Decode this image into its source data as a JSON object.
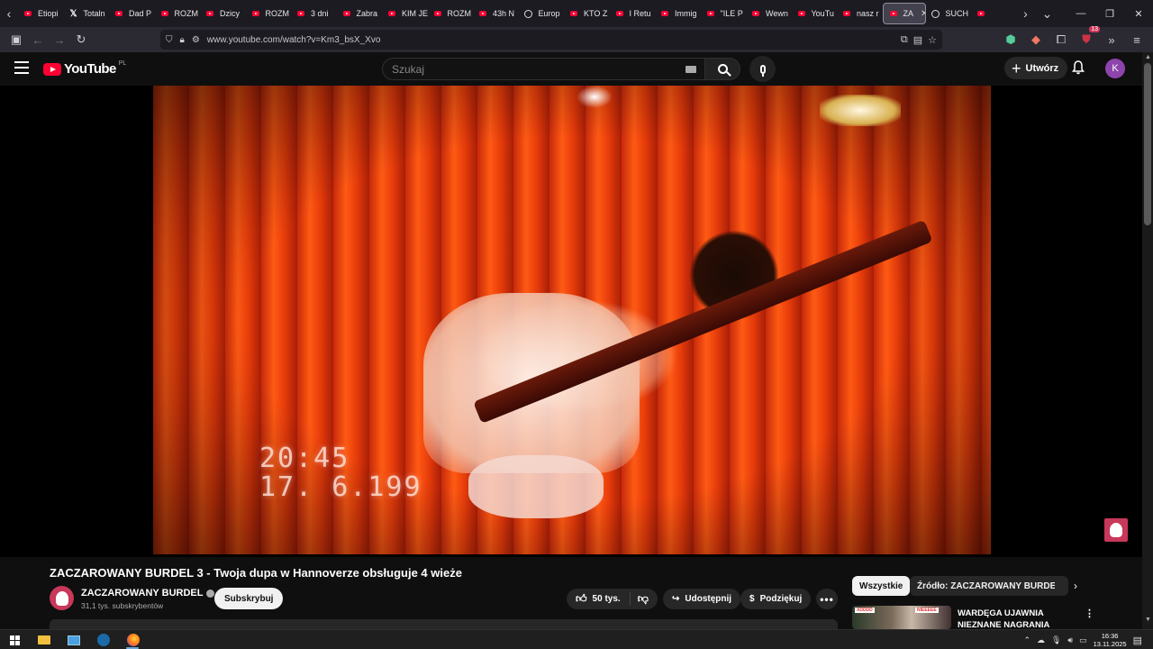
{
  "browser": {
    "tabs": [
      {
        "label": "Etiopi",
        "icon": "youtube-icon"
      },
      {
        "label": "Totaln",
        "icon": "x-icon"
      },
      {
        "label": "Dad P",
        "icon": "youtube-icon"
      },
      {
        "label": "ROZM",
        "icon": "youtube-icon"
      },
      {
        "label": "Dzicy",
        "icon": "youtube-icon"
      },
      {
        "label": "ROZM",
        "icon": "youtube-icon"
      },
      {
        "label": "3 dni",
        "icon": "youtube-icon"
      },
      {
        "label": "Zabra",
        "icon": "youtube-icon"
      },
      {
        "label": "KIM JE",
        "icon": "youtube-icon"
      },
      {
        "label": "ROZM",
        "icon": "youtube-icon"
      },
      {
        "label": "43h N",
        "icon": "youtube-icon"
      },
      {
        "label": "Europ",
        "icon": "globe-icon"
      },
      {
        "label": "KTO Z",
        "icon": "youtube-icon"
      },
      {
        "label": "I Retu",
        "icon": "youtube-icon"
      },
      {
        "label": "Immig",
        "icon": "youtube-icon"
      },
      {
        "label": "\"ILE P",
        "icon": "youtube-icon"
      },
      {
        "label": "Wewn",
        "icon": "youtube-icon"
      },
      {
        "label": "YouTu",
        "icon": "youtube-icon"
      },
      {
        "label": "nasz r",
        "icon": "youtube-icon"
      },
      {
        "label": "ZA",
        "icon": "youtube-icon",
        "active": true
      },
      {
        "label": "SUCH",
        "icon": "play-circle-icon"
      },
      {
        "label": "",
        "icon": "youtube-icon"
      }
    ],
    "url": "www.youtube.com/watch?v=Km3_bsX_Xvo",
    "extension_badge": "13"
  },
  "youtube": {
    "logo_text": "YouTube",
    "country_code": "PL",
    "search_placeholder": "Szukaj",
    "create_label": "Utwórz",
    "avatar_letter": "K"
  },
  "video": {
    "overlay_time": "20:45",
    "overlay_date": "17. 6.199",
    "title": "ZACZAROWANY BURDEL 3 - Twoja dupa w Hannoverze obsługuje 4 wieże",
    "channel_name": "ZACZAROWANY BURDEL",
    "subscribers": "31,1 tys. subskrybentów",
    "subscribe_label": "Subskrybuj",
    "likes": "50 tys.",
    "share_label": "Udostępnij",
    "thanks_label": "Podziękuj"
  },
  "sidebar": {
    "chips": [
      "Wszystkie",
      "Źródło: ZACZAROWANY BURDEL"
    ],
    "recommended": {
      "title": "WARDĘGA UJAWNIA NIEZNANE NAGRANIA BOXDELA",
      "thumb_tags": [
        "XDDDD",
        "NIEEEEE"
      ]
    }
  },
  "taskbar": {
    "time": "16:36",
    "date": "13.11.2025"
  },
  "colors": {
    "youtube_red": "#ff0033",
    "background": "#0f0f0f",
    "avatar": "#8e44ad",
    "channel_avatar": "#c7385a"
  }
}
